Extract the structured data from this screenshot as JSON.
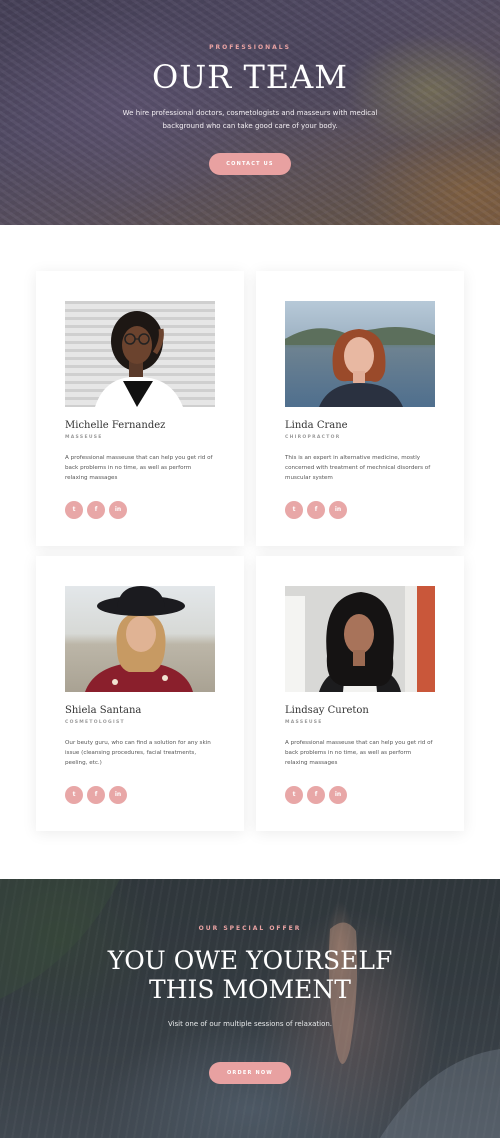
{
  "hero": {
    "eyebrow": "PROFESSIONALS",
    "title": "OUR TEAM",
    "text": "We hire professional doctors, cosmetologists and masseurs with medical background who can take good care of your body.",
    "button": "CONTACT US"
  },
  "team": {
    "members": [
      {
        "name": "Michelle Fernandez",
        "role": "MASSEUSE",
        "bio": "A professional masseuse that can help you get rid of back problems in no time, as well as perform relaxing massages",
        "socials": [
          {
            "icon": "twitter-icon",
            "glyph": "t"
          },
          {
            "icon": "facebook-icon",
            "glyph": "f"
          },
          {
            "icon": "linkedin-icon",
            "glyph": "in"
          }
        ]
      },
      {
        "name": "Linda Crane",
        "role": "CHIROPRACTOR",
        "bio": "This is an expert in alternative medicine, mostly concerned with treatment of mechnical disorders of muscular system",
        "socials": [
          {
            "icon": "twitter-icon",
            "glyph": "t"
          },
          {
            "icon": "facebook-icon",
            "glyph": "f"
          },
          {
            "icon": "linkedin-icon",
            "glyph": "in"
          }
        ]
      },
      {
        "name": "Shiela Santana",
        "role": "COSMETOLOGIST",
        "bio": "Our beuty guru, who can find a solution for any skin issue (cleansing procedures, facial treatments, peeling, etc.)",
        "socials": [
          {
            "icon": "twitter-icon",
            "glyph": "t"
          },
          {
            "icon": "facebook-icon",
            "glyph": "f"
          },
          {
            "icon": "linkedin-icon",
            "glyph": "in"
          }
        ]
      },
      {
        "name": "Lindsay Cureton",
        "role": "MASSEUSE",
        "bio": "A professional masseuse that can help you get rid of back problems in no time, as well as perform relaxing massages",
        "socials": [
          {
            "icon": "twitter-icon",
            "glyph": "t"
          },
          {
            "icon": "facebook-icon",
            "glyph": "f"
          },
          {
            "icon": "linkedin-icon",
            "glyph": "in"
          }
        ]
      }
    ]
  },
  "offer": {
    "eyebrow": "OUR SPECIAL OFFER",
    "title_line1": "YOU OWE YOURSELF",
    "title_line2": "THIS MOMENT",
    "text": "Visit one of our multiple sessions of relaxation.",
    "button": "ORDER NOW"
  },
  "colors": {
    "accent": "#e8a1a1",
    "text": "#333333"
  }
}
